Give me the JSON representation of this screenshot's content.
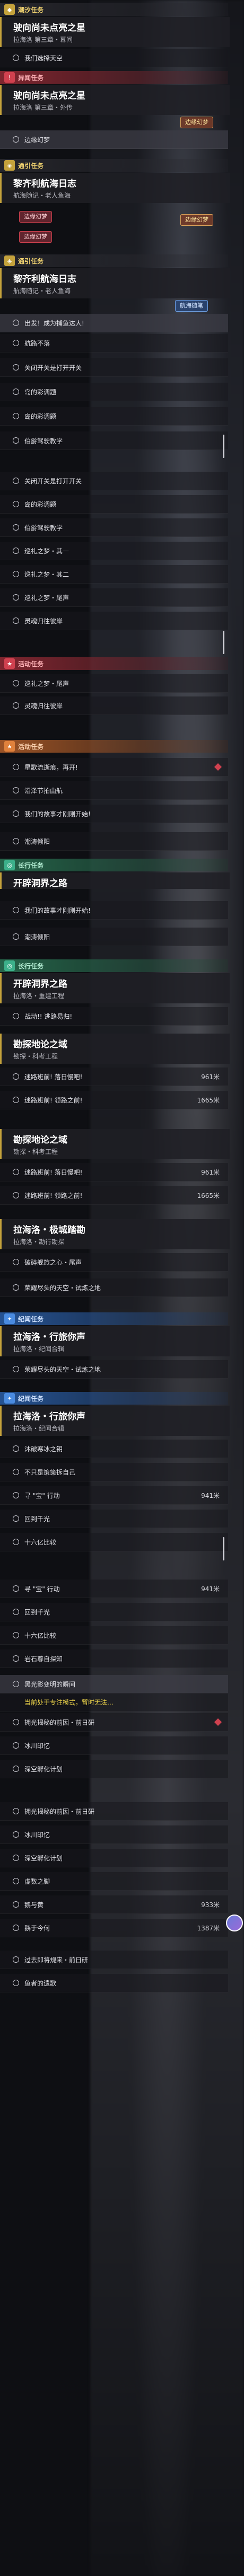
{
  "headers": {
    "h1": "潮汐任务",
    "h2": "异闻任务",
    "h3": "通引任务",
    "h4": "通引任务",
    "h5": "活动任务",
    "h6": "活动任务",
    "h7": "长行任务",
    "h8": "长行任务",
    "h9": "长行任务",
    "h10": "纪闻任务",
    "h11": "纪闻任务"
  },
  "quests": {
    "q1": {
      "title": "驶向尚未点亮之星",
      "sub": "拉海洛 第三章・幕间"
    },
    "q2": {
      "title": "驶向尚未点亮之星",
      "sub": "拉海洛 第三章・外传"
    },
    "q3": {
      "title": "黎齐利航海日志",
      "sub": "航海随记・老人鱼海"
    },
    "q4": {
      "title": "黎齐利航海日志",
      "sub": "航海随记・老人鱼海"
    },
    "q5": {
      "title": "开辟洞界之路",
      "sub": ""
    },
    "q6": {
      "title": "开辟洞界之路",
      "sub": "拉海洛・重建工程"
    },
    "q7": {
      "title": "勘探地论之域",
      "sub": "勘探・科考工程"
    },
    "q8": {
      "title": "勘探地论之域",
      "sub": "勘探・科考工程"
    },
    "q9": {
      "title": "拉海洛・极城踏勘",
      "sub": "拉海洛・勘行勘探"
    },
    "q10": {
      "title": "拉海洛・行旅你声",
      "sub": "拉海洛・纪闻合辑"
    },
    "q11": {
      "title": "拉海洛・行旅你声",
      "sub": "拉海洛・纪闻合辑"
    }
  },
  "badges": {
    "b1": "边缘幻梦",
    "b2": "边缘幻梦",
    "b3": "边缘幻梦",
    "b4": "边缘幻梦",
    "b5": "航海随笔"
  },
  "rows": [
    {
      "text": "我们选择天空"
    },
    {
      "text": "边缘幻梦"
    },
    {
      "text": "出发！成为捕鱼达人!"
    },
    {
      "text": "航路不落"
    },
    {
      "text": "关闭开关是打开开关"
    },
    {
      "text": "岛的彩调题"
    },
    {
      "text": "岛的彩调题"
    },
    {
      "text": "伯爵驾驶教学"
    },
    {
      "text": "关闭开关是打开开关"
    },
    {
      "text": "岛的彩调题"
    },
    {
      "text": "伯爵驾驶教学"
    },
    {
      "text": "巡礼之梦・其一"
    },
    {
      "text": "巡礼之梦・其二"
    },
    {
      "text": "巡礼之梦・尾声"
    },
    {
      "text": "灵魂归往彼岸"
    },
    {
      "text": "巡礼之梦・尾声"
    },
    {
      "text": "灵魂归往彼岸"
    },
    {
      "text": "星歌流逝痕，再开!"
    },
    {
      "text": "沼泽节拍由航"
    },
    {
      "text": "我们的故事才刚刚开始!"
    },
    {
      "text": "潮涛倾阳"
    },
    {
      "text": "我们的故事才刚刚开始!"
    },
    {
      "text": "潮涛倾阳"
    },
    {
      "text": "战动!! 逃路易归!"
    },
    {
      "text": "迷路班前! 落日慢吧!",
      "val": "961米"
    },
    {
      "text": "迷路班前! 领路之前!",
      "val": "1665米"
    },
    {
      "text": "迷路班前! 落日慢吧!",
      "val": "961米"
    },
    {
      "text": "迷路班前! 领路之前!",
      "val": "1665米"
    },
    {
      "text": "破碎舰旅之心・尾声"
    },
    {
      "text": "荣耀尽头的天空・试炼之地"
    },
    {
      "text": "荣耀尽头的天空・试炼之地"
    },
    {
      "text": "沐破寒冰之钥"
    },
    {
      "text": "不只是策策拆自己"
    },
    {
      "text": "寻 \"宝\" 行动",
      "val": "941米"
    },
    {
      "text": "回到千光"
    },
    {
      "text": "十六亿比较"
    },
    {
      "text": "寻 \"宝\" 行动",
      "val": "941米"
    },
    {
      "text": "回到千光"
    },
    {
      "text": "十六亿比较"
    },
    {
      "text": "岩石尊自探知"
    },
    {
      "text": "黑光影变明的瞬间"
    },
    {
      "text": "当前处于专注模式，暂时无法...",
      "warn": true
    },
    {
      "text": "拥光揭秘的前因・前日研"
    },
    {
      "text": "冰川印忆"
    },
    {
      "text": "深空孵化计划"
    },
    {
      "text": "拥光揭秘的前因・前日研"
    },
    {
      "text": "冰川印忆"
    },
    {
      "text": "深空孵化计划"
    },
    {
      "text": "虚数之脚"
    },
    {
      "text": "鹅与黄",
      "val": "933米"
    },
    {
      "text": "鹅于今何",
      "val": "1387米"
    },
    {
      "text": "过去即将规来・前日研"
    },
    {
      "text": "鱼者的遗歌"
    }
  ]
}
